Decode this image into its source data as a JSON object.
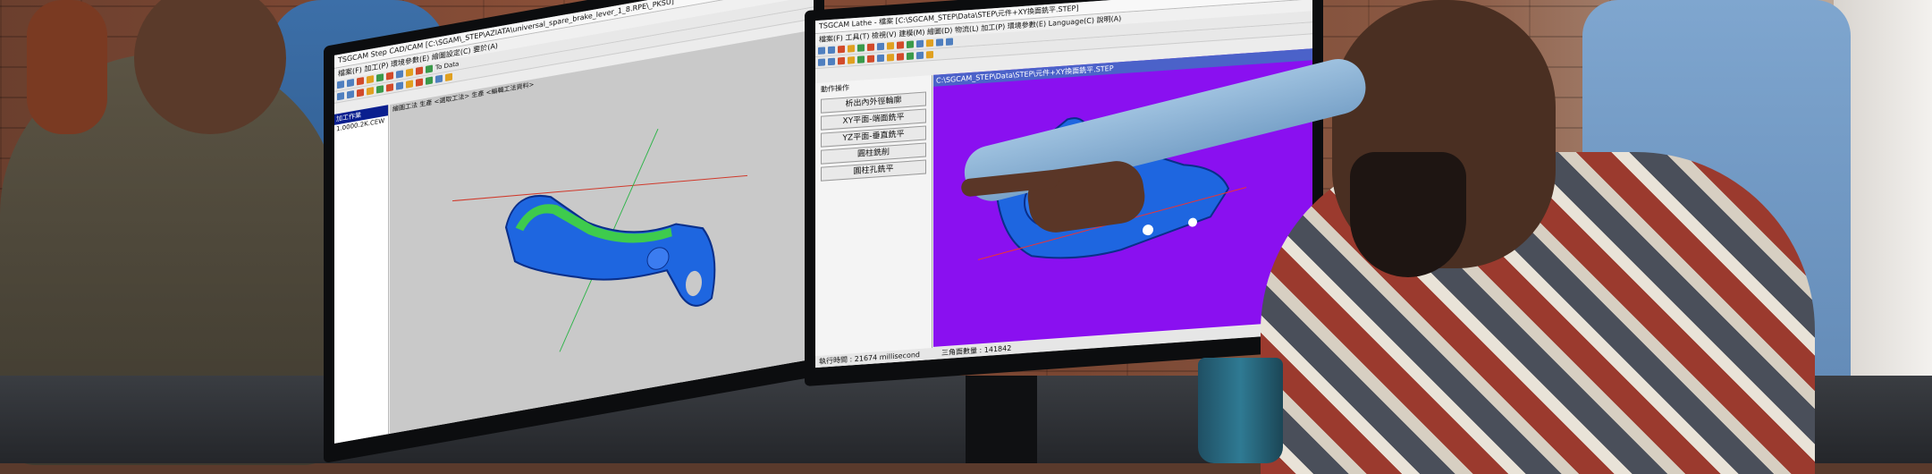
{
  "colors": {
    "viewport_purple": "#8a10f0",
    "viewport_gray": "#c9c9c9",
    "part_blue": "#1e66e0",
    "highlight_green": "#44dd33",
    "tree_selected": "#0a1f8f"
  },
  "left_monitor": {
    "title": "TSGCAM Step CAD/CAM [C:\\SGAM\\_STEP\\AZIATA\\universal_spare_brake_lever_1_8.RPE\\_PKSU]",
    "menu": "檔案(F)  加工(P)  環境參數(E)  繪圖設定(C)  要於(A)",
    "toolbar_label": "To Data",
    "tree": {
      "selected": "加工作業",
      "node": "1.0000.2K.CEW"
    },
    "breadcrumb": "繪圖工法 生產 <選取工法> 生產 <編輯工法資料>"
  },
  "right_monitor": {
    "title": "TSGCAM Lathe  -  檔案 [C:\\SGCAM_STEP\\Data\\STEP\\元件+XY換面銑平.STEP]",
    "menu": "檔案(F)  工具(T)  檢視(V)  建模(M)  繪圖(D)  物流(L)  加工(P)  環境參數(E)  Language(C)  說明(A)",
    "path": "C:\\SGCAM_STEP\\Data\\STEP\\元件+XY換面銑平.STEP",
    "panel_title": "動作操作",
    "buttons": [
      "析出內外徑輪廓",
      "XY平面-端面銑平",
      "YZ平面-垂直銑平",
      "圓柱銑削",
      "圓柱孔銑平"
    ],
    "status": {
      "time": "執行時間 : 21674 millisecond",
      "triangles": "三角面數量 : 141842"
    }
  }
}
